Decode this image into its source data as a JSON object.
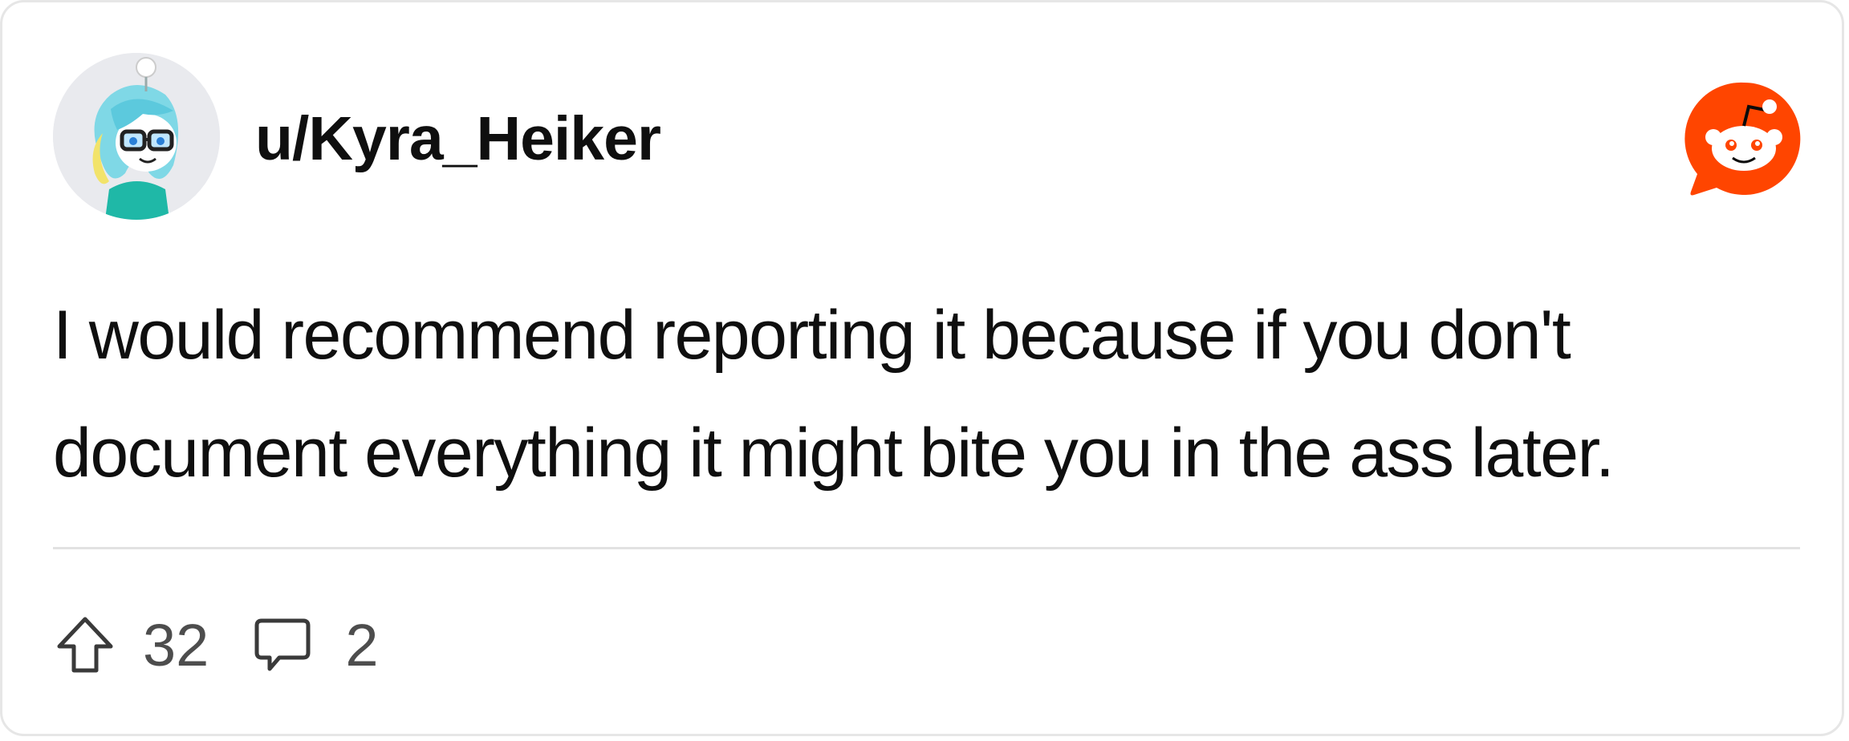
{
  "post": {
    "username": "u/Kyra_Heiker",
    "body": "I would recommend reporting it because if you don't document everything it might bite you in the ass later.",
    "upvote_count": "32",
    "comment_count": "2"
  },
  "icons": {
    "avatar": "user-avatar",
    "brand": "reddit-logo-icon",
    "upvote": "upvote-arrow-icon",
    "comments": "comment-bubble-icon"
  },
  "colors": {
    "brand": "#ff4500",
    "text": "#0f0f0f",
    "muted": "#4d4d4d",
    "divider": "#e2e2e2",
    "border": "#e6e6e6"
  }
}
